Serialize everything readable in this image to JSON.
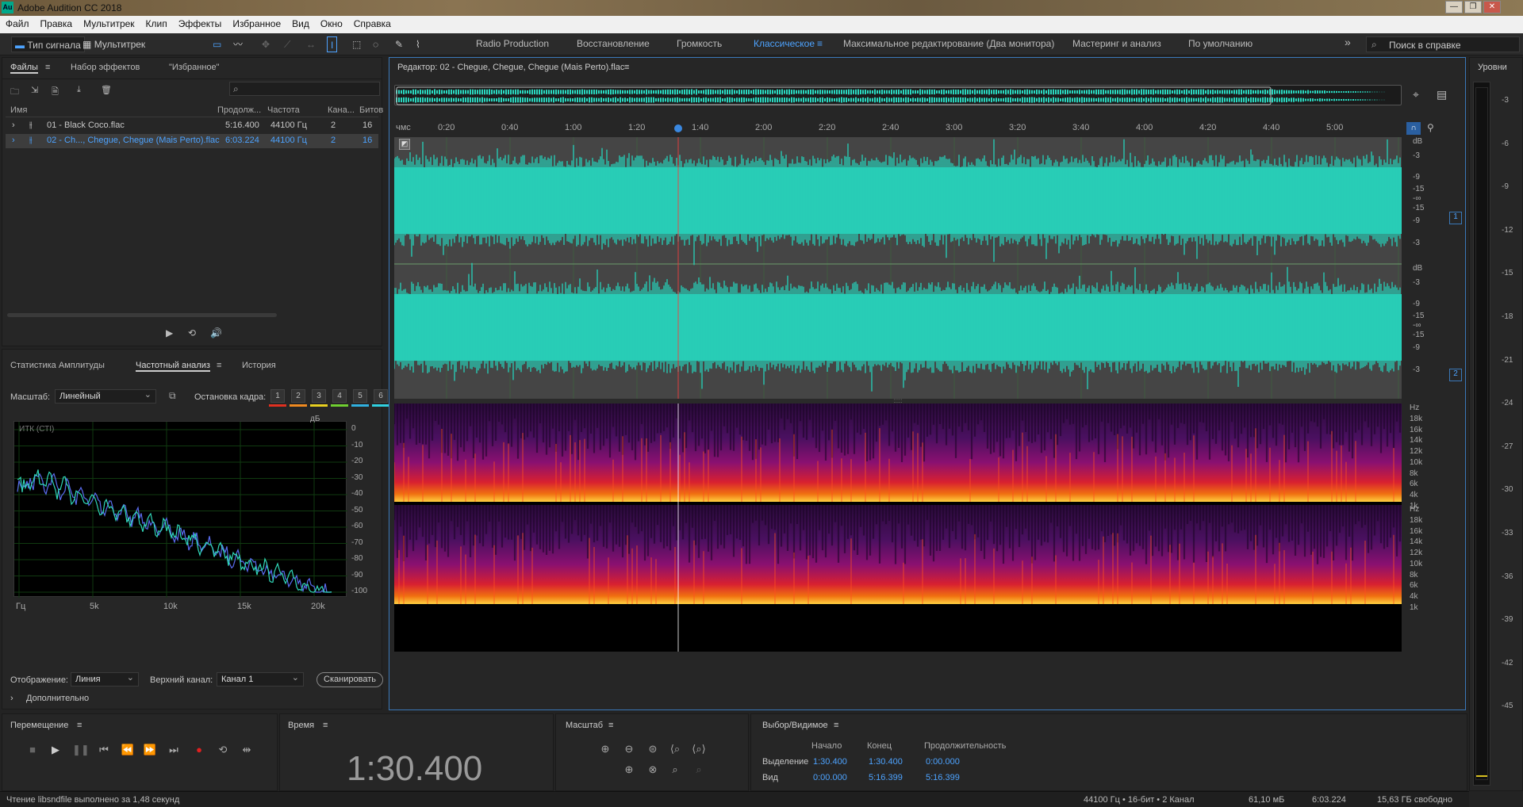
{
  "window": {
    "title": "Adobe Audition CC 2018",
    "app_icon": "Au"
  },
  "menu": [
    "Файл",
    "Правка",
    "Мультитрек",
    "Клип",
    "Эффекты",
    "Избранное",
    "Вид",
    "Окно",
    "Справка"
  ],
  "toolbar": {
    "waveform_label": "Тип сигнала",
    "multitrack_label": "Мультитрек",
    "workspaces": [
      "Radio Production",
      "Восстановление",
      "Громкость",
      "Классическое",
      "Максимальное редактирование (Два монитора)",
      "Мастеринг и анализ",
      "По умолчанию"
    ],
    "active_workspace": "Классическое",
    "search_placeholder": "Поиск в справке"
  },
  "files_panel": {
    "tabs": [
      "Файлы",
      "Набор эффектов",
      "\"Избранное\""
    ],
    "columns": [
      "Имя",
      "Продолж...",
      "Частота",
      "Кана...",
      "Битов"
    ],
    "rows": [
      {
        "name": "01 - Black Coco.flac",
        "duration": "5:16.400",
        "rate": "44100 Гц",
        "channels": "2",
        "bits": "16",
        "selected": false
      },
      {
        "name": "02 - Ch..., Chegue, Chegue (Mais Perto).flac",
        "duration": "6:03.224",
        "rate": "44100 Гц",
        "channels": "2",
        "bits": "16",
        "selected": true
      }
    ]
  },
  "analysis_panel": {
    "tabs": [
      "Статистика Амплитуды",
      "Частотный анализ",
      "История"
    ],
    "scale_label": "Масштаб:",
    "scale_value": "Линейный",
    "freeze_label": "Остановка кадра:",
    "freeze_buttons": [
      "1",
      "2",
      "3",
      "4",
      "5",
      "6"
    ],
    "freeze_colors": [
      "#e03020",
      "#f08a20",
      "#e8d020",
      "#6fcf30",
      "#30b0e0",
      "#30d0e0"
    ],
    "graph_label": "ИТК (СТІ)",
    "db_unit": "дБ",
    "db_ticks": [
      "0",
      "-10",
      "-20",
      "-30",
      "-40",
      "-50",
      "-60",
      "-70",
      "-80",
      "-90",
      "-100"
    ],
    "freq_ticks": [
      "Гц",
      "5k",
      "10k",
      "15k",
      "20k"
    ],
    "display_label": "Отображение:",
    "display_value": "Линия",
    "channel_label": "Верхний канал:",
    "channel_value": "Канал 1",
    "scan_label": "Сканировать",
    "advanced_label": "Дополнительно"
  },
  "editor": {
    "title": "Редактор: 02 - Chegue, Chegue, Chegue (Mais Perto).flac",
    "ruler_unit": "чмс",
    "ruler_ticks": [
      "0:20",
      "0:40",
      "1:00",
      "1:20",
      "1:40",
      "2:00",
      "2:20",
      "2:40",
      "3:00",
      "3:20",
      "3:40",
      "4:00",
      "4:20",
      "4:40",
      "5:00"
    ],
    "db_labels": [
      "dB",
      "-3",
      "-9",
      "-15",
      "-∞",
      "-15",
      "-9",
      "-3"
    ],
    "channels": [
      "1",
      "2"
    ],
    "hz_labels": [
      "Hz",
      "18k",
      "16k",
      "14k",
      "12k",
      "10k",
      "8k",
      "6k",
      "4k",
      "1k"
    ],
    "wave_color": "#2ad8c0"
  },
  "levels_panel": {
    "title": "Уровни",
    "ticks": [
      "-3",
      "-6",
      "-9",
      "-12",
      "-15",
      "-18",
      "-21",
      "-24",
      "-27",
      "-30",
      "-33",
      "-36",
      "-39",
      "-42",
      "-45"
    ]
  },
  "transport": {
    "title": "Перемещение"
  },
  "time": {
    "title": "Время",
    "value": "1:30.400"
  },
  "zoom": {
    "title": "Масштаб"
  },
  "selection": {
    "title": "Выбор/Видимое",
    "headers": [
      "Начало",
      "Конец",
      "Продолжительность"
    ],
    "rows": [
      {
        "label": "Выделение",
        "start": "1:30.400",
        "end": "1:30.400",
        "duration": "0:00.000"
      },
      {
        "label": "Вид",
        "start": "0:00.000",
        "end": "5:16.399",
        "duration": "5:16.399"
      }
    ]
  },
  "status": {
    "message": "Чтение libsndfile выполнено за 1,48 секунд",
    "format": "44100 Гц • 16-бит • 2 Канал",
    "size": "61,10 мБ",
    "duration": "6:03.224",
    "free": "15,63 ГБ свободно"
  }
}
